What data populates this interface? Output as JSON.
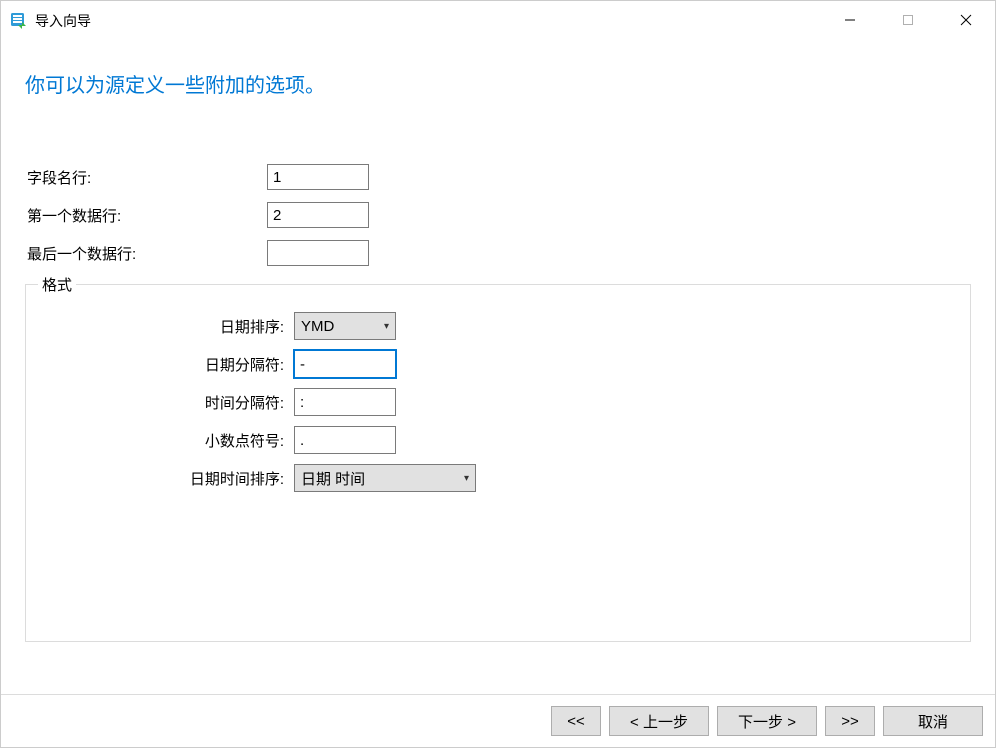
{
  "window": {
    "title": "导入向导"
  },
  "heading": "你可以为源定义一些附加的选项。",
  "fields": {
    "fieldNameRow": {
      "label": "字段名行:",
      "value": "1"
    },
    "firstDataRow": {
      "label": "第一个数据行:",
      "value": "2"
    },
    "lastDataRow": {
      "label": "最后一个数据行:",
      "value": ""
    }
  },
  "format": {
    "legend": "格式",
    "dateOrder": {
      "label": "日期排序:",
      "value": "YMD"
    },
    "dateDelimiter": {
      "label": "日期分隔符:",
      "value": "-"
    },
    "timeDelimiter": {
      "label": "时间分隔符:",
      "value": ":"
    },
    "decimalSymbol": {
      "label": "小数点符号:",
      "value": "."
    },
    "dateTimeOrder": {
      "label": "日期时间排序:",
      "value": "日期 时间"
    }
  },
  "footer": {
    "first": "<<",
    "back": "< 上一步",
    "next": "下一步 >",
    "last": ">>",
    "cancel": "取消"
  }
}
